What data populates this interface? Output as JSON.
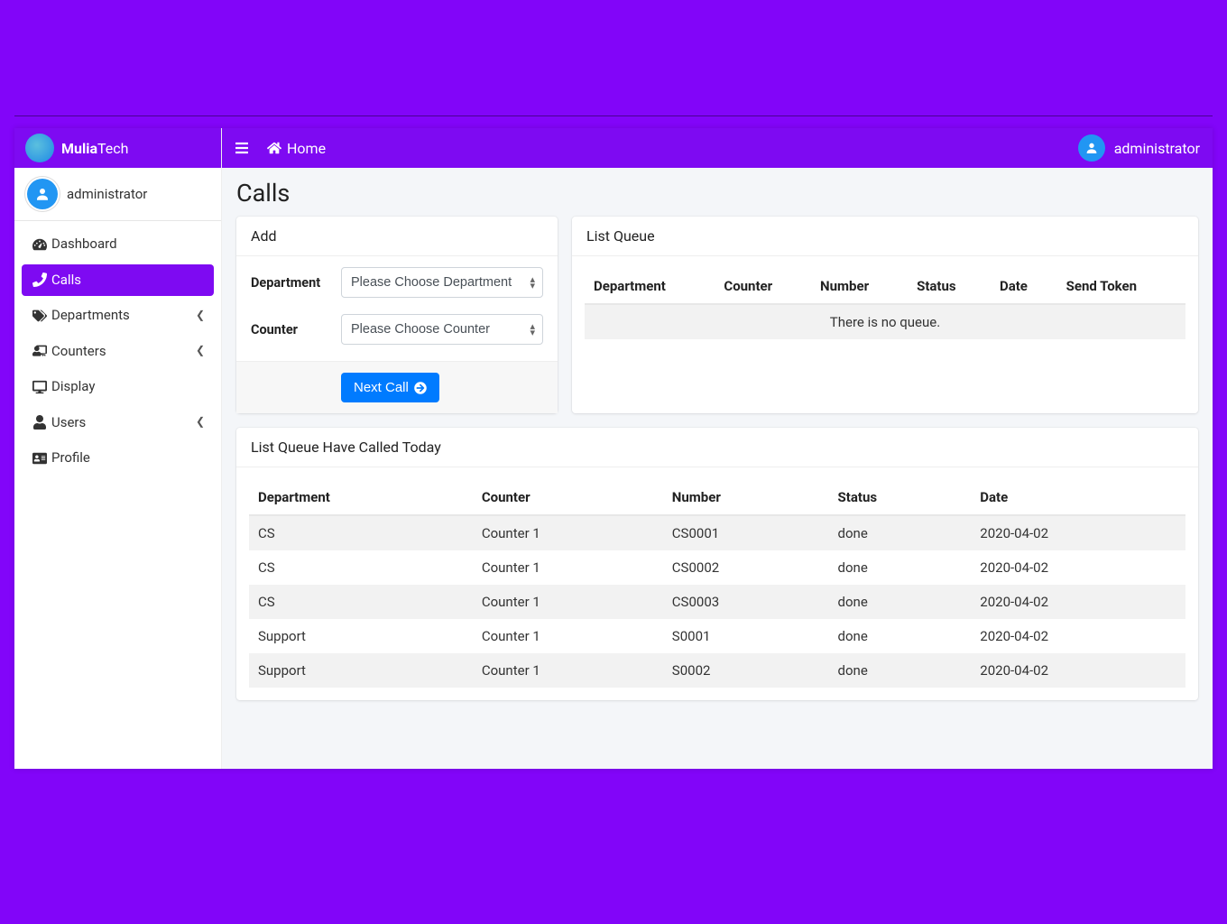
{
  "brand": {
    "bold": "Mulia",
    "light": "Tech"
  },
  "sidebar_user": {
    "name": "administrator"
  },
  "nav": {
    "dashboard": "Dashboard",
    "calls": "Calls",
    "departments": "Departments",
    "counters": "Counters",
    "display": "Display",
    "users": "Users",
    "profile": "Profile"
  },
  "topbar": {
    "home": "Home",
    "user": "administrator"
  },
  "page": {
    "title": "Calls"
  },
  "add_card": {
    "title": "Add",
    "department_label": "Department",
    "department_placeholder": "Please Choose Department",
    "counter_label": "Counter",
    "counter_placeholder": "Please Choose Counter",
    "next_call": "Next Call"
  },
  "queue_card": {
    "title": "List Queue",
    "headers": [
      "Department",
      "Counter",
      "Number",
      "Status",
      "Date",
      "Send Token"
    ],
    "empty": "There is no queue."
  },
  "called_card": {
    "title": "List Queue Have Called Today",
    "headers": [
      "Department",
      "Counter",
      "Number",
      "Status",
      "Date"
    ],
    "rows": [
      {
        "department": "CS",
        "counter": "Counter 1",
        "number": "CS0001",
        "status": "done",
        "date": "2020-04-02"
      },
      {
        "department": "CS",
        "counter": "Counter 1",
        "number": "CS0002",
        "status": "done",
        "date": "2020-04-02"
      },
      {
        "department": "CS",
        "counter": "Counter 1",
        "number": "CS0003",
        "status": "done",
        "date": "2020-04-02"
      },
      {
        "department": "Support",
        "counter": "Counter 1",
        "number": "S0001",
        "status": "done",
        "date": "2020-04-02"
      },
      {
        "department": "Support",
        "counter": "Counter 1",
        "number": "S0002",
        "status": "done",
        "date": "2020-04-02"
      }
    ]
  }
}
